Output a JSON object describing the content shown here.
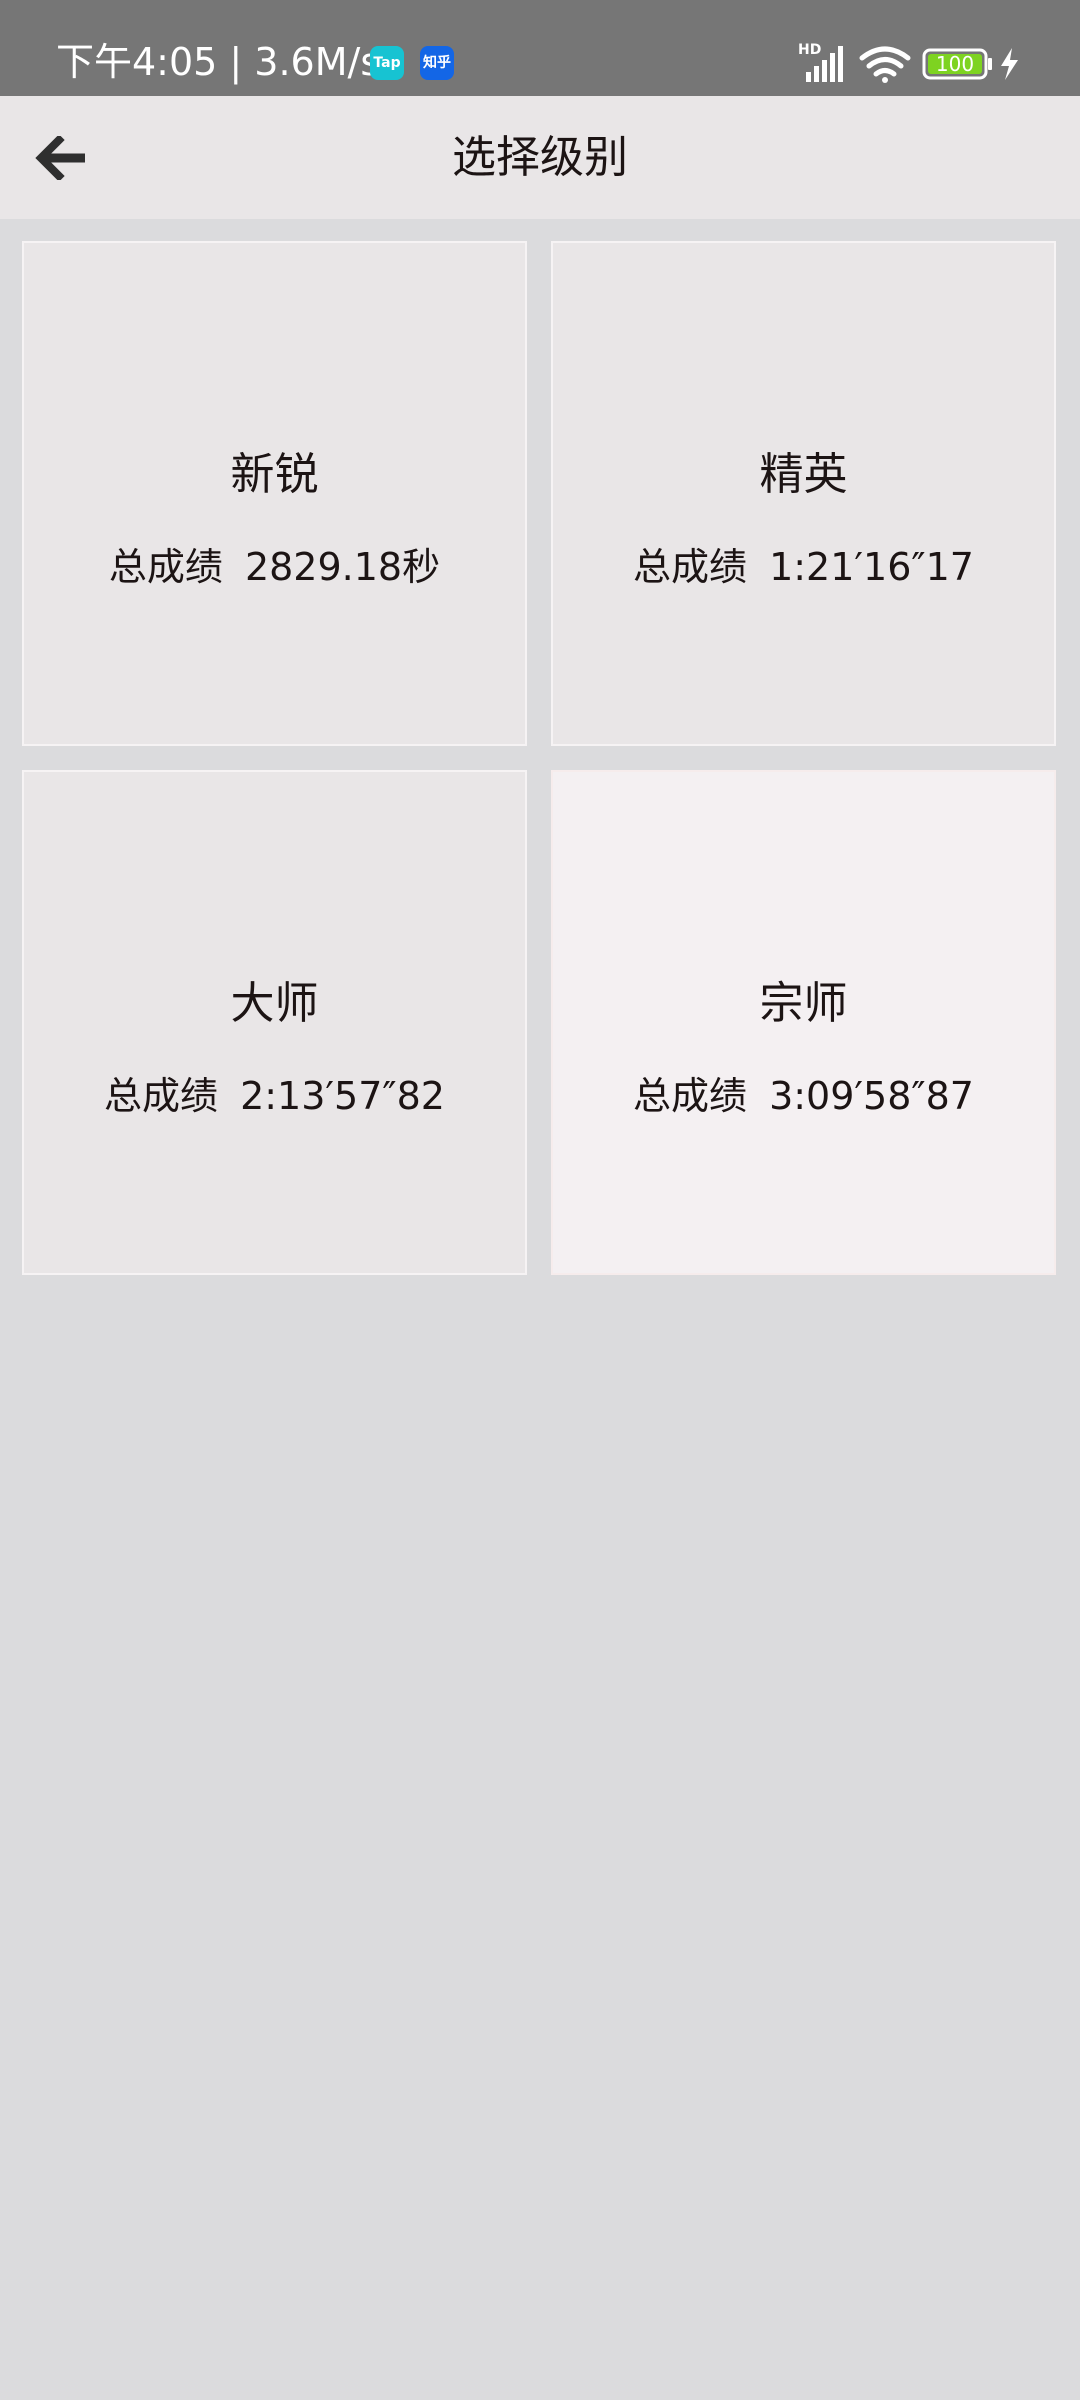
{
  "status_bar": {
    "time_speed": "下午4:05 | 3.6M/s",
    "tap_badge": "Tap",
    "zhihu_badge": "知乎",
    "network_label": "HD",
    "battery": "100",
    "icons": [
      "signal-icon",
      "wifi-icon",
      "battery-icon",
      "charging-icon"
    ]
  },
  "header": {
    "title": "选择级别",
    "back_icon": "arrow-left-icon"
  },
  "levels": [
    {
      "name": "新锐",
      "score_label": "总成绩",
      "score": "2829.18秒",
      "selected": false
    },
    {
      "name": "精英",
      "score_label": "总成绩",
      "score": "1:21′16″17",
      "selected": false
    },
    {
      "name": "大师",
      "score_label": "总成绩",
      "score": "2:13′57″82",
      "selected": false
    },
    {
      "name": "宗师",
      "score_label": "总成绩",
      "score": "3:09′58″87",
      "selected": true
    }
  ],
  "colors": {
    "status_bar": "#767676",
    "app_bar": "#e9e6e7",
    "page_background": "#dbdbdd",
    "card": "#e9e6e7",
    "card_selected": "#f4f0f2",
    "battery_fill": "#7ed321",
    "text": "#1c1414"
  }
}
